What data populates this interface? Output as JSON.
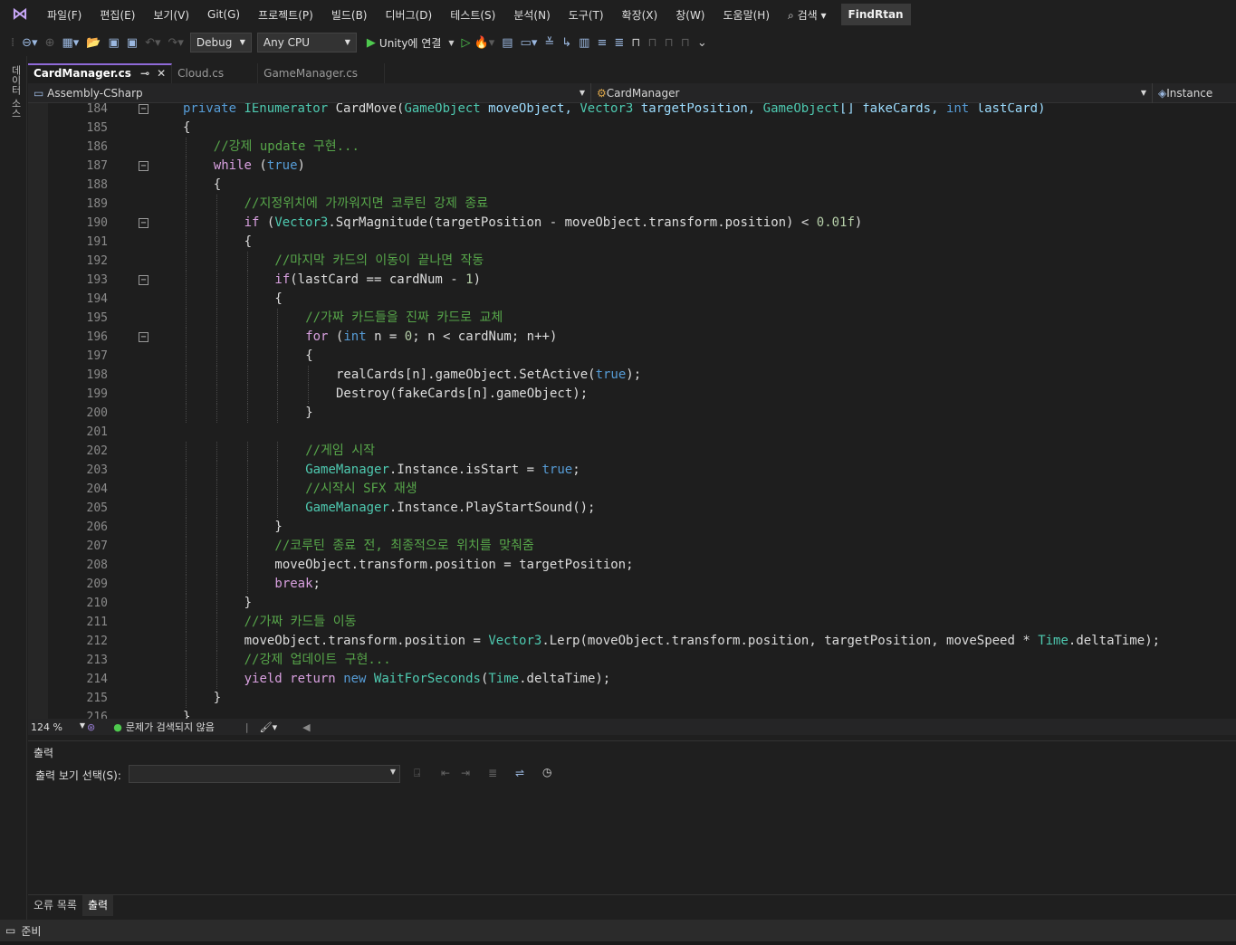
{
  "menu": {
    "items": [
      "파일(F)",
      "편집(E)",
      "보기(V)",
      "Git(G)",
      "프로젝트(P)",
      "빌드(B)",
      "디버그(D)",
      "테스트(S)",
      "분석(N)",
      "도구(T)",
      "확장(X)",
      "창(W)",
      "도움말(H)"
    ],
    "search_label": "검색",
    "app_name": "FindRtan"
  },
  "toolbar": {
    "config": "Debug",
    "platform": "Any CPU",
    "run_label": "Unity에 연결"
  },
  "left_strip_label": "데이터 소스",
  "tabs": [
    {
      "label": "CardManager.cs",
      "active": true
    },
    {
      "label": "Cloud.cs",
      "active": false
    },
    {
      "label": "GameManager.cs",
      "active": false
    }
  ],
  "nav": {
    "project": "Assembly-CSharp",
    "class": "CardManager",
    "member": "Instance"
  },
  "code_lines": [
    {
      "n": "184"
    },
    {
      "n": "185"
    },
    {
      "n": "186"
    },
    {
      "n": "187"
    },
    {
      "n": "188"
    },
    {
      "n": "189"
    },
    {
      "n": "190"
    },
    {
      "n": "191"
    },
    {
      "n": "192"
    },
    {
      "n": "193"
    },
    {
      "n": "194"
    },
    {
      "n": "195"
    },
    {
      "n": "196"
    },
    {
      "n": "197"
    },
    {
      "n": "198"
    },
    {
      "n": "199"
    },
    {
      "n": "200"
    },
    {
      "n": "201"
    },
    {
      "n": "202"
    },
    {
      "n": "203"
    },
    {
      "n": "204"
    },
    {
      "n": "205"
    },
    {
      "n": "206"
    },
    {
      "n": "207"
    },
    {
      "n": "208"
    },
    {
      "n": "209"
    },
    {
      "n": "210"
    },
    {
      "n": "211"
    },
    {
      "n": "212"
    },
    {
      "n": "213"
    },
    {
      "n": "214"
    },
    {
      "n": "215"
    },
    {
      "n": "216"
    }
  ],
  "code_text": {
    "l184": [
      "private ",
      "IEnumerator",
      " CardMove(",
      "GameObject",
      " moveObject, ",
      "Vector3",
      " targetPosition, ",
      "GameObject",
      "[] fakeCards, ",
      "int",
      " lastCard)"
    ],
    "l186": "//강제 update 구현...",
    "l187a": "while",
    "l187b": "true",
    "l189": "//지정위치에 가까워지면 코루틴 강제 종료",
    "l190": [
      "if",
      " (",
      "Vector3",
      ".SqrMagnitude(targetPosition - moveObject.transform.position) < ",
      "0.01f",
      ")"
    ],
    "l192": "//마지막 카드의 이동이 끝나면 작동",
    "l193": [
      "if",
      "(lastCard == cardNum - ",
      "1",
      ")"
    ],
    "l195": "//가짜 카드들을 진짜 카드로 교체",
    "l196": [
      "for",
      " (",
      "int",
      " n = ",
      "0",
      "; n < cardNum; n++)"
    ],
    "l198": [
      "realCards[n].gameObject.SetActive(",
      "true",
      ");"
    ],
    "l199": "Destroy(fakeCards[n].gameObject);",
    "l202": "//게임 시작",
    "l203": [
      "GameManager",
      ".Instance.isStart = ",
      "true",
      ";"
    ],
    "l204": "//시작시 SFX 재생",
    "l205": [
      "GameManager",
      ".Instance.PlayStartSound();"
    ],
    "l207": "//코루틴 종료 전, 최종적으로 위치를 맞춰줌",
    "l208": "moveObject.transform.position = targetPosition;",
    "l209": "break",
    "l211": "//가짜 카드들 이동",
    "l212": [
      "moveObject.transform.position = ",
      "Vector3",
      ".Lerp(moveObject.transform.position, targetPosition, moveSpeed * ",
      "Time",
      ".deltaTime);"
    ],
    "l213": "//강제 업데이트 구현...",
    "l214": [
      "yield return",
      " ",
      "new",
      " ",
      "WaitForSeconds",
      "(",
      "Time",
      ".deltaTime);"
    ]
  },
  "status": {
    "zoom": "124 %",
    "issues": "문제가 검색되지 않음"
  },
  "output": {
    "title": "출력",
    "show_from_label": "출력 보기 선택(S):",
    "show_from_value": ""
  },
  "bottom_tabs": [
    "오류 목록",
    "출력"
  ],
  "statusbar": {
    "text": "준비"
  },
  "colors": {
    "keyword": "#569cd6",
    "type": "#4ec9b0",
    "comment": "#57a64a",
    "control": "#d8a0df",
    "accent": "#8f6ad8"
  }
}
